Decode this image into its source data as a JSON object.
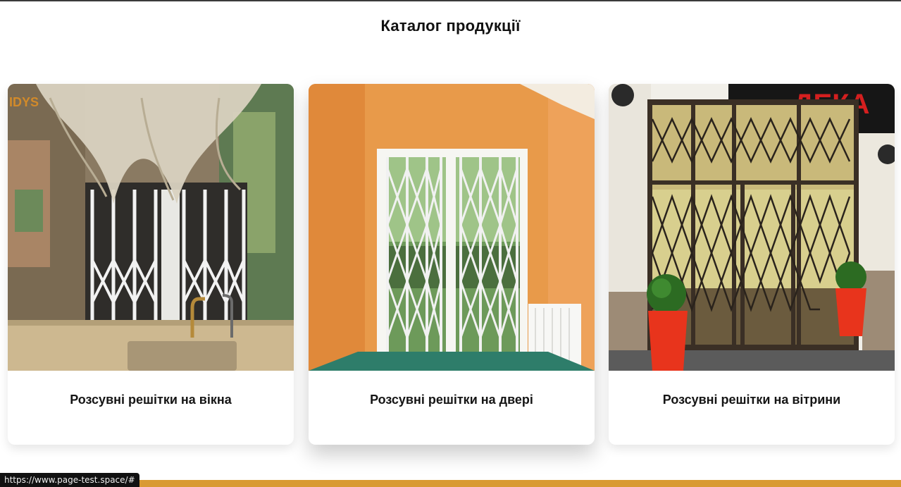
{
  "catalog": {
    "title": "Каталог продукції",
    "cards": [
      {
        "caption": "Розсувні решітки на вікна",
        "image": "window-grille-photo"
      },
      {
        "caption": "Розсувні решітки на двері",
        "image": "door-grille-photo"
      },
      {
        "caption": "Розсувні решітки на вітрини",
        "image": "storefront-grille-photo"
      }
    ]
  },
  "photo_text": {
    "card1_sign": "IDYS",
    "card3_sign": "ДЕКА"
  },
  "status_bar": {
    "url": "https://www.page-test.space/#"
  },
  "colors": {
    "accent_bar": "#d99a33",
    "caption_text": "#151515"
  }
}
